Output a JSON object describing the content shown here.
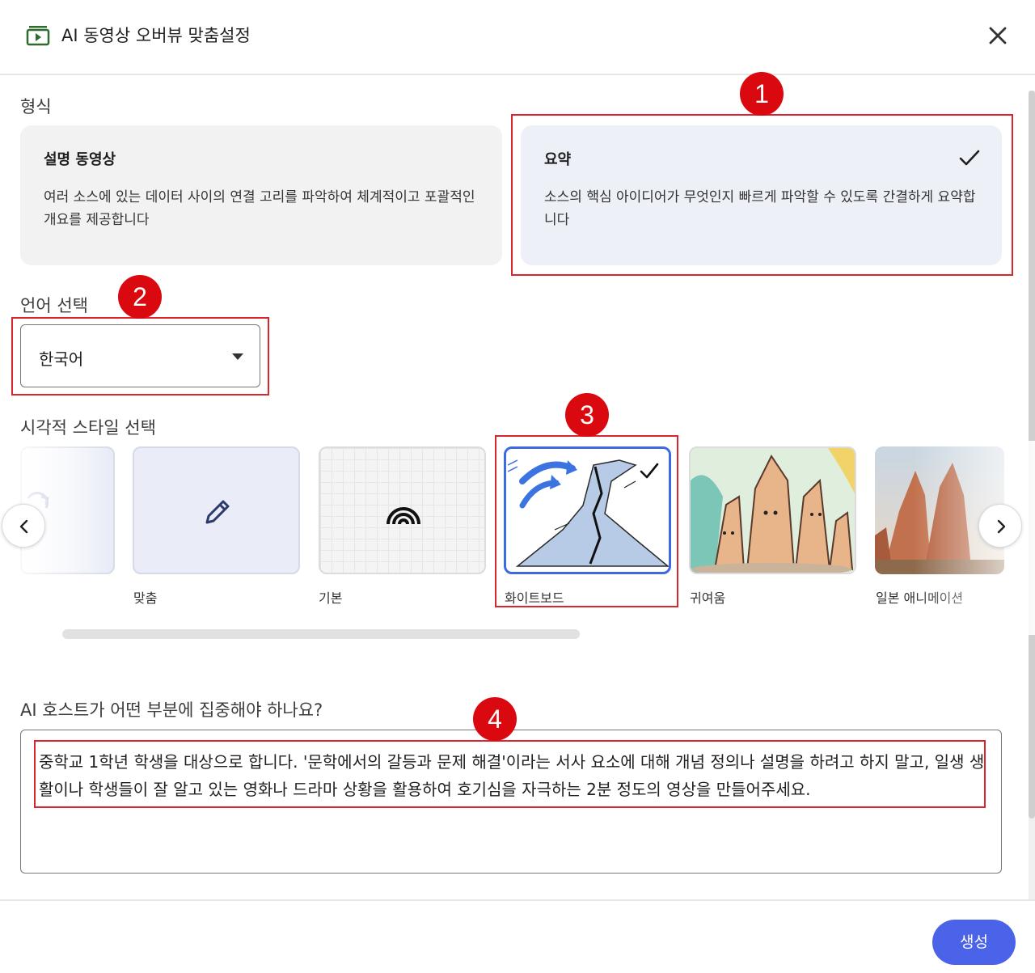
{
  "header": {
    "title": "AI 동영상 오버뷰 맞춤설정",
    "icon": "video-overview-icon",
    "close_icon": "close-icon"
  },
  "format": {
    "label": "형식",
    "options": [
      {
        "title": "설명 동영상",
        "description": "여러 소스에 있는 데이터 사이의 연결 고리를 파악하여 체계적이고 포괄적인 개요를 제공합니다",
        "selected": false
      },
      {
        "title": "요약",
        "description": "소스의 핵심 아이디어가 무엇인지 빠르게 파악할 수 있도록 간결하게 요약합니다",
        "selected": true
      }
    ]
  },
  "language": {
    "label": "언어 선택",
    "selected": "한국어"
  },
  "visual_style": {
    "label": "시각적 스타일 선택",
    "tiles": [
      {
        "label": "맞춤",
        "icon": "pencil-icon",
        "selected": false
      },
      {
        "label": "기본",
        "icon": "rainbow-icon",
        "selected": false
      },
      {
        "label": "화이트보드",
        "icon": "volcano-sketch",
        "selected": true
      },
      {
        "label": "귀여움",
        "icon": "cute-rocks",
        "selected": false
      },
      {
        "label": "일본 애니메이션",
        "icon": "anime-rocks",
        "selected": false
      }
    ]
  },
  "focus": {
    "label": "AI 호스트가 어떤 부분에 집중해야 하나요?",
    "value": "중학교 1학년 학생을 대상으로 합니다. '문학에서의 갈등과 문제 해결'이라는 서사 요소에 대해 개념 정의나 설명을 하려고 하지 말고, 일생 생활이나 학생들이 잘 알고 있는 영화나 드라마 상황을 활용하여 호기심을 자극하는 2분 정도의 영상을 만들어주세요."
  },
  "annotations": [
    "1",
    "2",
    "3",
    "4"
  ],
  "footer": {
    "generate_label": "생성"
  },
  "colors": {
    "accent": "#4b63e8",
    "annotation_red": "#d9262c",
    "selected_border": "#3d6ae0"
  }
}
